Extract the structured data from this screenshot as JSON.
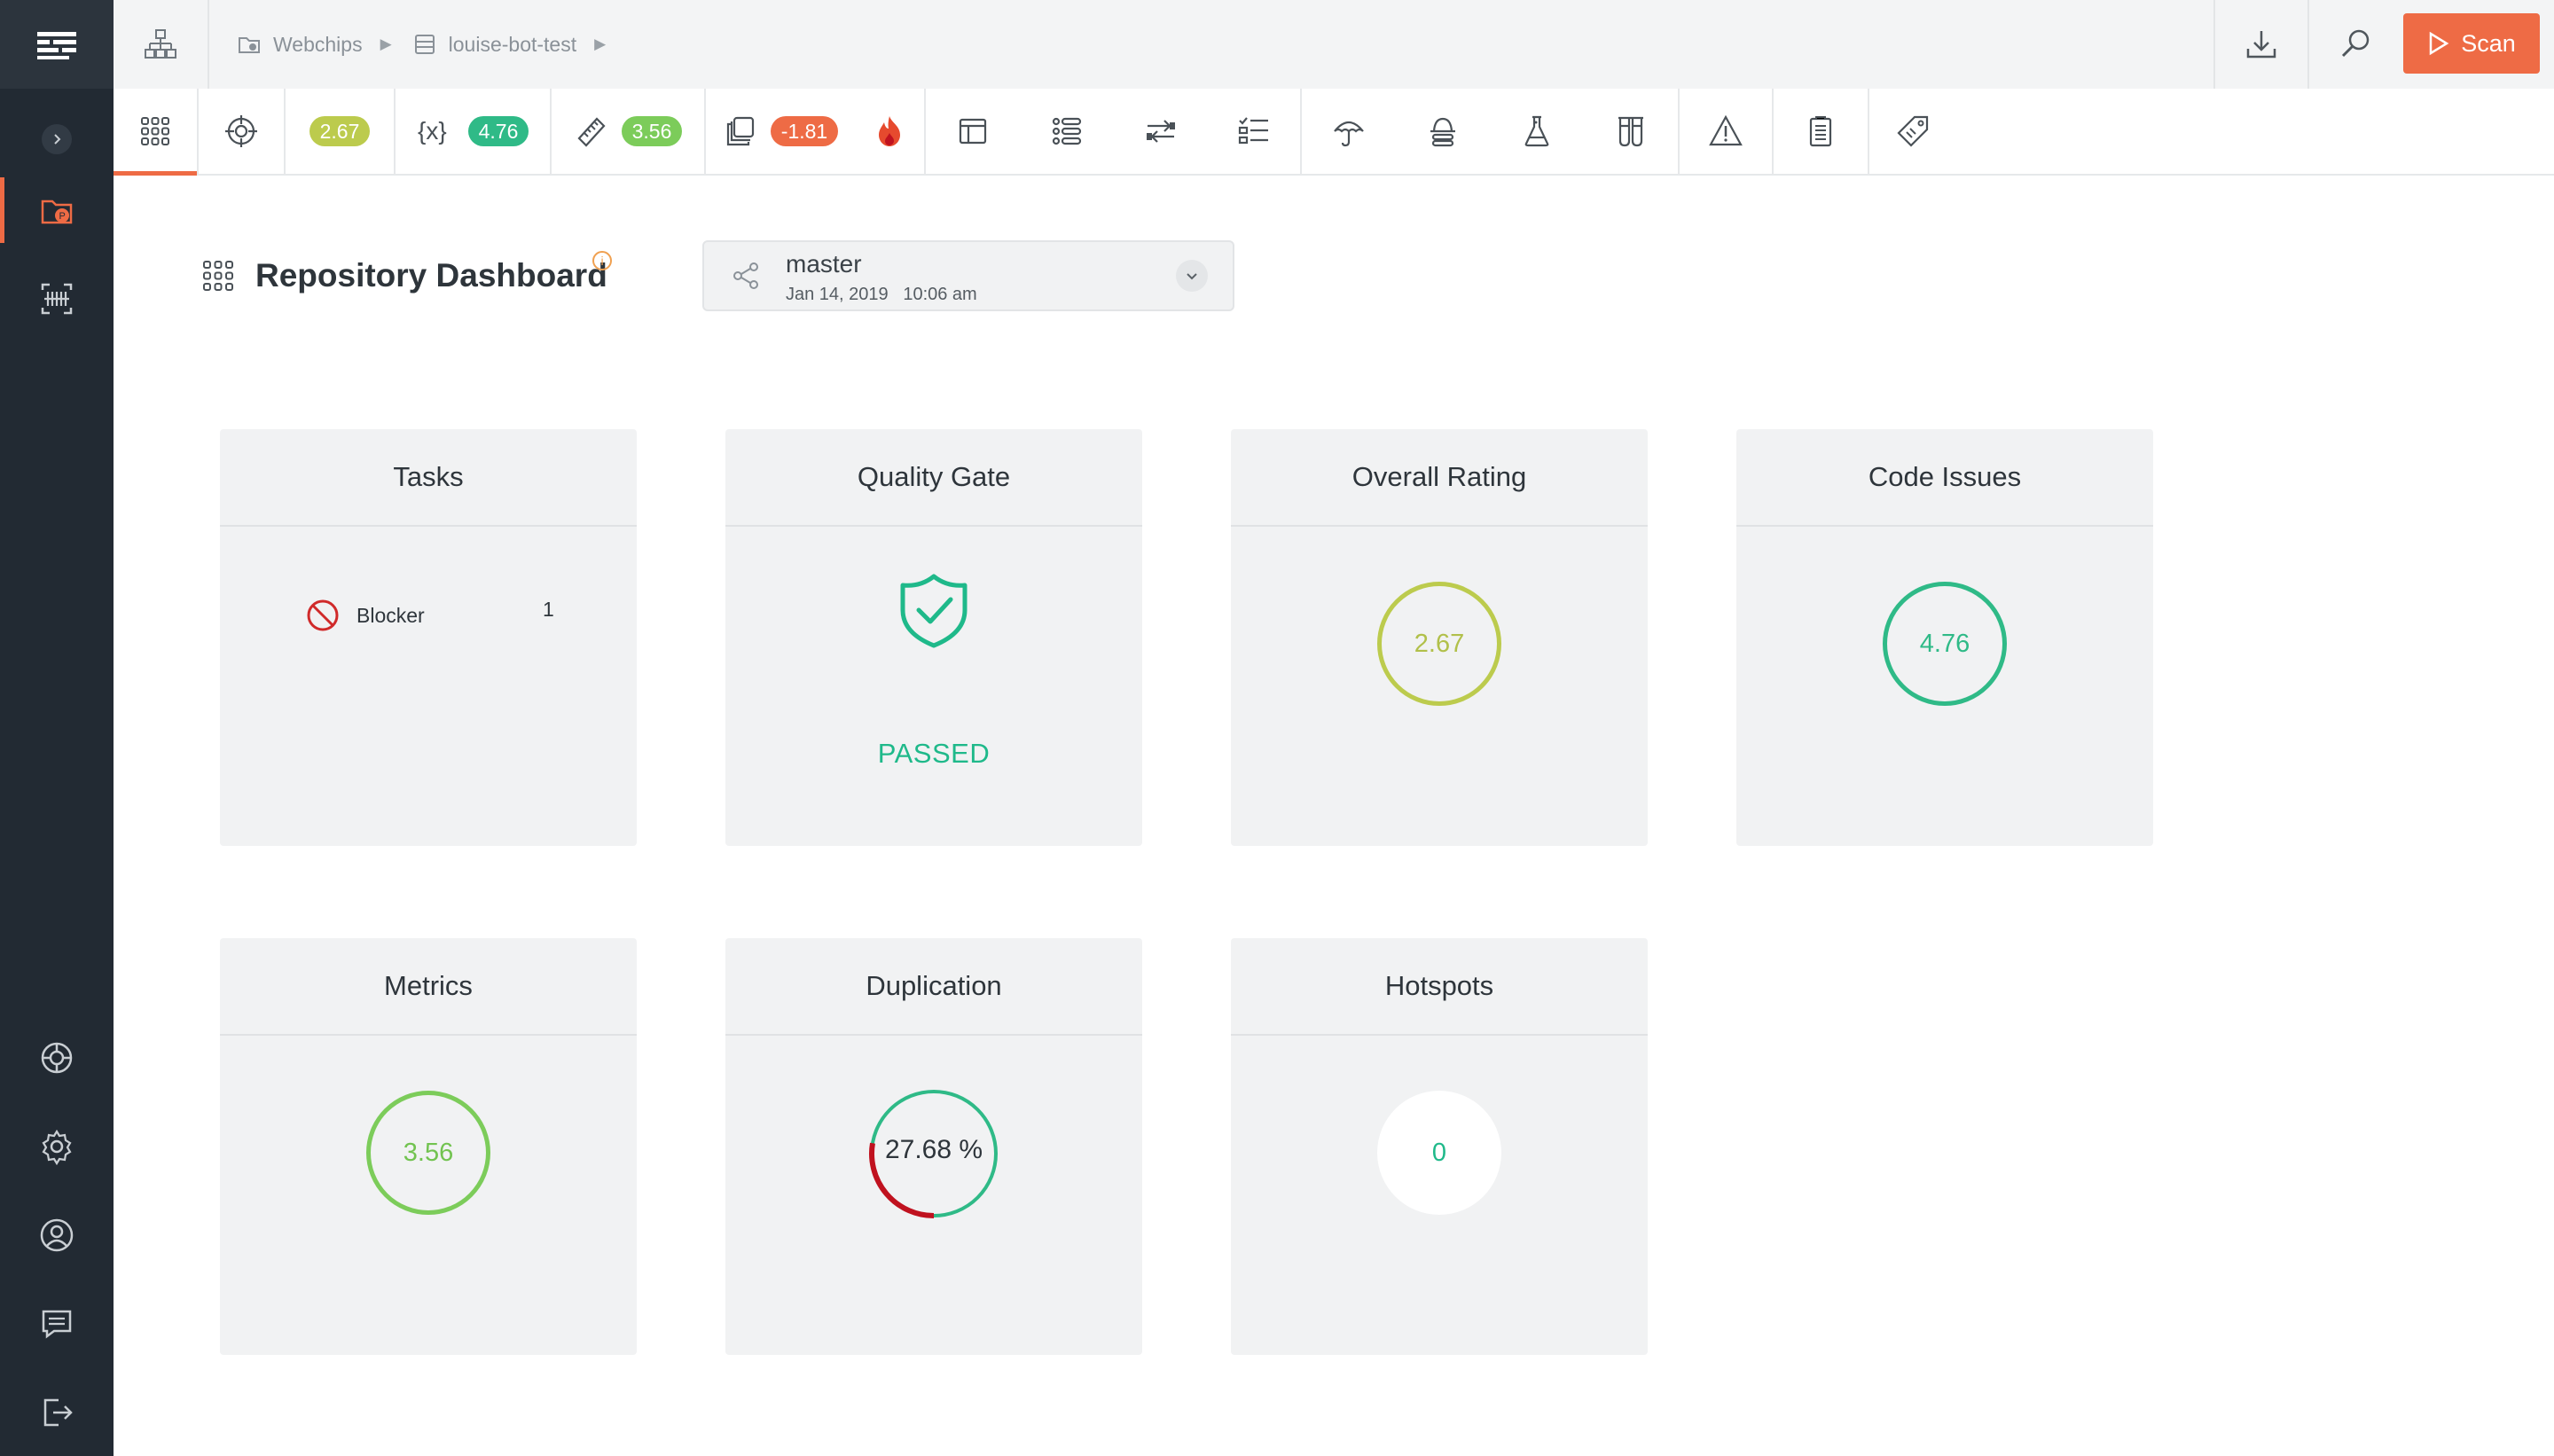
{
  "breadcrumb": {
    "org": "Webchips",
    "repo": "louise-bot-test"
  },
  "header": {
    "scan_label": "Scan"
  },
  "toolbar": {
    "rating_badge": "2.67",
    "issues_badge": "4.76",
    "metrics_badge": "3.56",
    "duplication_badge": "-1.81"
  },
  "page": {
    "title": "Repository Dashboard",
    "info_mark": "i",
    "branch": {
      "name": "master",
      "date": "Jan 14, 2019   10:06 am"
    }
  },
  "cards": {
    "tasks": {
      "title": "Tasks",
      "item_label": "Blocker",
      "item_count": "1"
    },
    "quality_gate": {
      "title": "Quality Gate",
      "status": "PASSED"
    },
    "overall_rating": {
      "title": "Overall Rating",
      "value": "2.67"
    },
    "code_issues": {
      "title": "Code Issues",
      "value": "4.76"
    },
    "metrics": {
      "title": "Metrics",
      "value": "3.56"
    },
    "duplication": {
      "title": "Duplication",
      "value": "27.68 %",
      "percent": 27.68
    },
    "hotspots": {
      "title": "Hotspots",
      "value": "0"
    }
  },
  "colors": {
    "accent": "#ee6b45",
    "rating_yellow": "#bccb4d",
    "issues_green": "#2fba87",
    "metrics_green": "#7ccc5a",
    "duplication_red": "#c0121f",
    "dup_badge": "#ee6b45"
  }
}
